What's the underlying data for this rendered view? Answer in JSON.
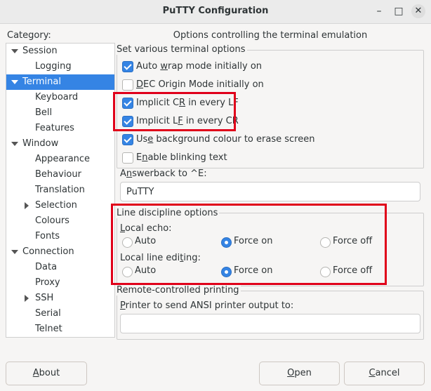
{
  "window": {
    "title": "PuTTY Configuration",
    "minimize_glyph": "–",
    "maximize_glyph": "□",
    "close_glyph": "✕"
  },
  "category_label": "Category:",
  "panel_header": "Options controlling the terminal emulation",
  "tree": [
    {
      "label": "Session",
      "level": 0,
      "expander": "down",
      "selected": false
    },
    {
      "label": "Logging",
      "level": 1,
      "expander": "none",
      "selected": false
    },
    {
      "label": "Terminal",
      "level": 0,
      "expander": "down",
      "selected": true
    },
    {
      "label": "Keyboard",
      "level": 1,
      "expander": "none",
      "selected": false
    },
    {
      "label": "Bell",
      "level": 1,
      "expander": "none",
      "selected": false
    },
    {
      "label": "Features",
      "level": 1,
      "expander": "none",
      "selected": false
    },
    {
      "label": "Window",
      "level": 0,
      "expander": "down",
      "selected": false
    },
    {
      "label": "Appearance",
      "level": 1,
      "expander": "none",
      "selected": false
    },
    {
      "label": "Behaviour",
      "level": 1,
      "expander": "none",
      "selected": false
    },
    {
      "label": "Translation",
      "level": 1,
      "expander": "none",
      "selected": false
    },
    {
      "label": "Selection",
      "level": 1,
      "expander": "right",
      "selected": false
    },
    {
      "label": "Colours",
      "level": 1,
      "expander": "none",
      "selected": false
    },
    {
      "label": "Fonts",
      "level": 1,
      "expander": "none",
      "selected": false
    },
    {
      "label": "Connection",
      "level": 0,
      "expander": "down",
      "selected": false
    },
    {
      "label": "Data",
      "level": 1,
      "expander": "none",
      "selected": false
    },
    {
      "label": "Proxy",
      "level": 1,
      "expander": "none",
      "selected": false
    },
    {
      "label": "SSH",
      "level": 1,
      "expander": "right",
      "selected": false
    },
    {
      "label": "Serial",
      "level": 1,
      "expander": "none",
      "selected": false
    },
    {
      "label": "Telnet",
      "level": 1,
      "expander": "none",
      "selected": false
    }
  ],
  "terminal_options": {
    "title": "Set various terminal options",
    "checkboxes": [
      {
        "label": "Auto wrap mode initially on",
        "checked": true
      },
      {
        "label": "DEC Origin Mode initially on",
        "checked": false
      },
      {
        "label": "Implicit CR in every LF",
        "checked": true
      },
      {
        "label": "Implicit LF in every CR",
        "checked": true
      },
      {
        "label": "Use background colour to erase screen",
        "checked": true
      },
      {
        "label": "Enable blinking text",
        "checked": false
      }
    ],
    "answerback_label": "Answerback to ^E:",
    "answerback_value": "PuTTY"
  },
  "line_discipline": {
    "title": "Line discipline options",
    "local_echo_label": "Local echo:",
    "local_echo_options": [
      "Auto",
      "Force on",
      "Force off"
    ],
    "local_echo_selected": "Force on",
    "local_editing_label": "Local line editing:",
    "local_editing_options": [
      "Auto",
      "Force on",
      "Force off"
    ],
    "local_editing_selected": "Force on"
  },
  "printing": {
    "title": "Remote-controlled printing",
    "printer_label": "Printer to send ANSI printer output to:",
    "printer_value": ""
  },
  "buttons": {
    "about": "About",
    "open": "Open",
    "cancel": "Cancel"
  },
  "highlight_color": "#e0001a",
  "accent_color": "#3584e4"
}
